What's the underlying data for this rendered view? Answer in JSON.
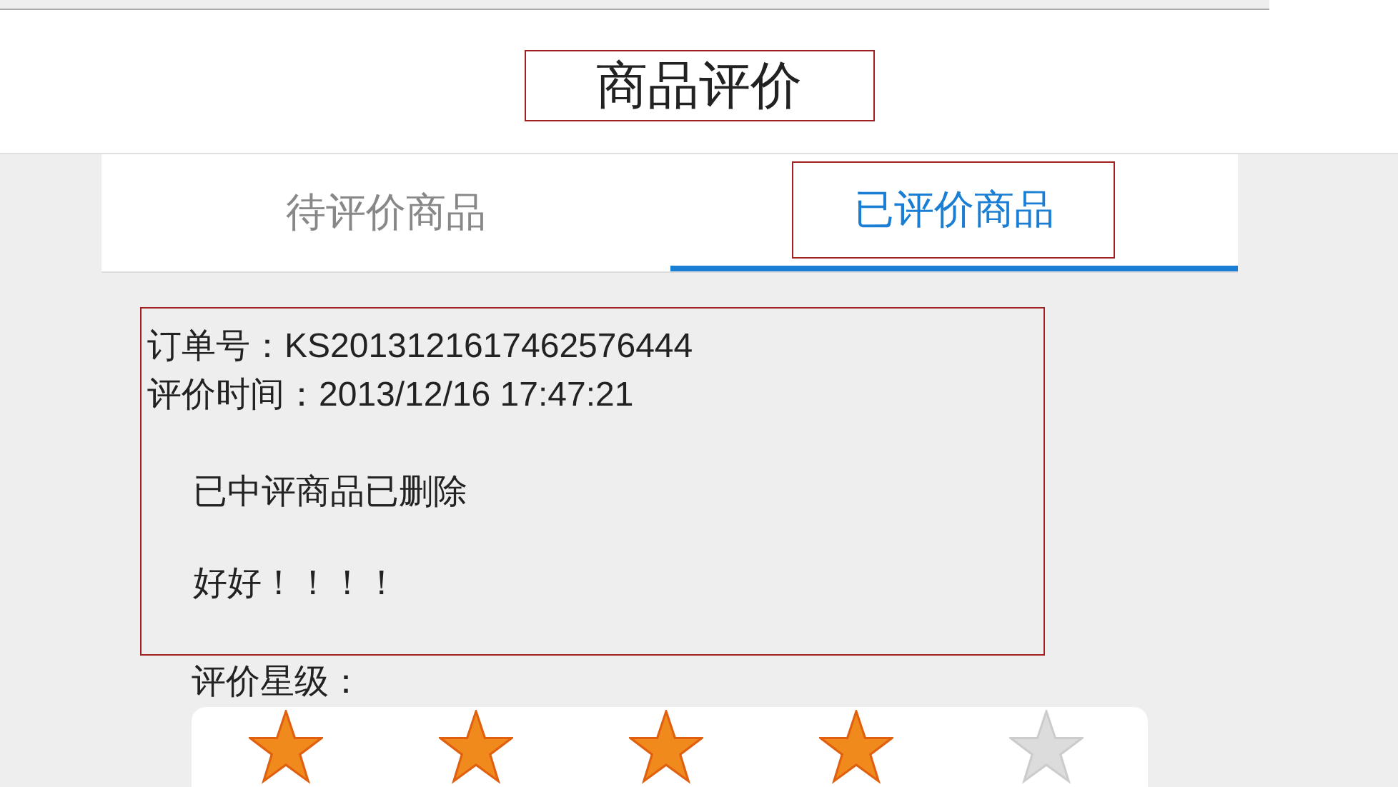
{
  "header": {
    "title": "商品评价"
  },
  "tabs": [
    {
      "label": "待评价商品",
      "selected": false
    },
    {
      "label": "已评价商品",
      "selected": true
    }
  ],
  "review": {
    "order_no": "订单号：KS2013121617462576444",
    "time": "评价时间：2013/12/16 17:47:21",
    "status": "已中评商品已删除",
    "comment": "好好！！！！"
  },
  "rating": {
    "label": "评价星级：",
    "stars": 4
  }
}
